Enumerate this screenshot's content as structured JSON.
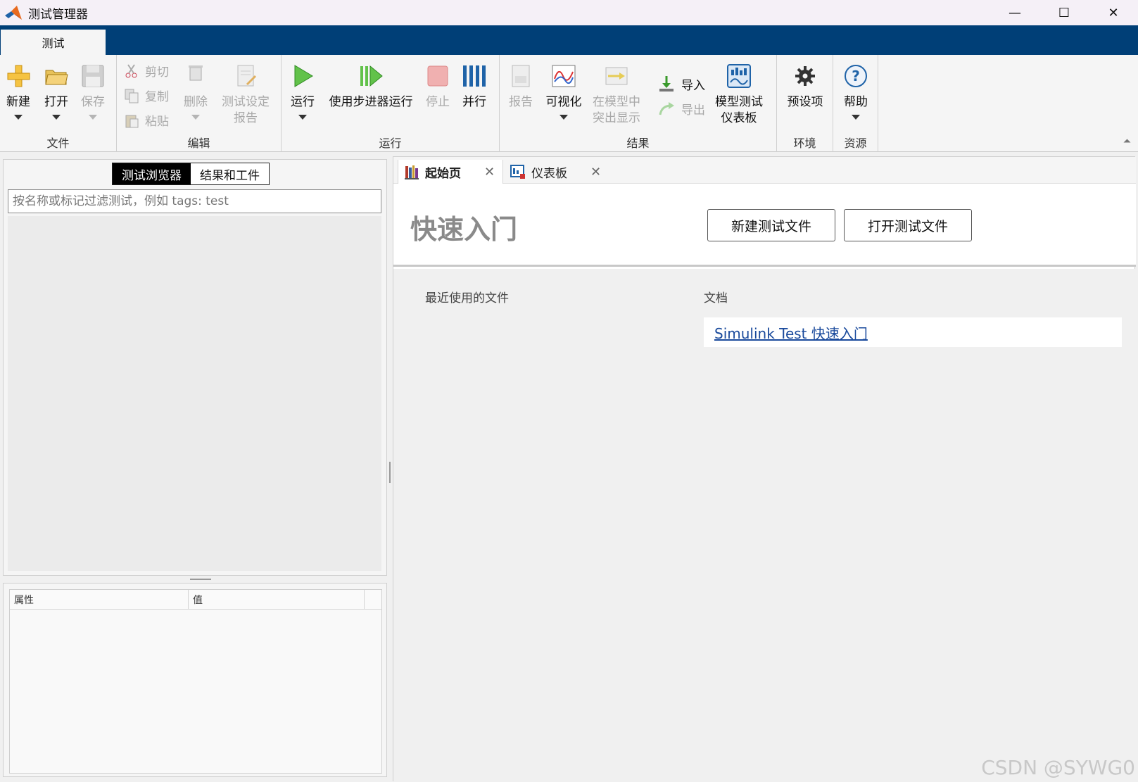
{
  "window": {
    "title": "测试管理器",
    "minimize": "—",
    "maximize": "☐",
    "close": "✕"
  },
  "ribbon": {
    "tab": "测试",
    "groups": {
      "file": "文件",
      "edit": "编辑",
      "run": "运行",
      "results": "结果",
      "environment": "环境",
      "resources": "资源"
    },
    "new": "新建",
    "open": "打开",
    "save": "保存",
    "cut": "剪切",
    "copy": "复制",
    "paste": "粘贴",
    "delete": "删除",
    "test_spec_report_1": "测试设定",
    "test_spec_report_2": "报告",
    "run": "运行",
    "run_stepper": "使用步进器运行",
    "stop": "停止",
    "parallel": "并行",
    "report": "报告",
    "visualize": "可视化",
    "highlight_1": "在模型中",
    "highlight_2": "突出显示",
    "import": "导入",
    "export": "导出",
    "dashboard_1": "模型测试",
    "dashboard_2": "仪表板",
    "preferences": "预设项",
    "help": "帮助"
  },
  "left": {
    "seg_browser": "测试浏览器",
    "seg_results": "结果和工件",
    "filter_placeholder": "按名称或标记过滤测试，例如 tags: test",
    "prop_col": "属性",
    "val_col": "值"
  },
  "doc_tabs": [
    {
      "label": "起始页",
      "close": "✕"
    },
    {
      "label": "仪表板",
      "close": "✕"
    }
  ],
  "start": {
    "title": "快速入门",
    "new_test_file": "新建测试文件",
    "open_test_file": "打开测试文件",
    "recent_files": "最近使用的文件",
    "docs": "文档",
    "doc_link": "Simulink Test 快速入门"
  },
  "watermark": "CSDN @SYWG0",
  "colors": {
    "tabstrip": "#003f77",
    "link": "#1a4a9c",
    "run_green": "#3aa832"
  }
}
